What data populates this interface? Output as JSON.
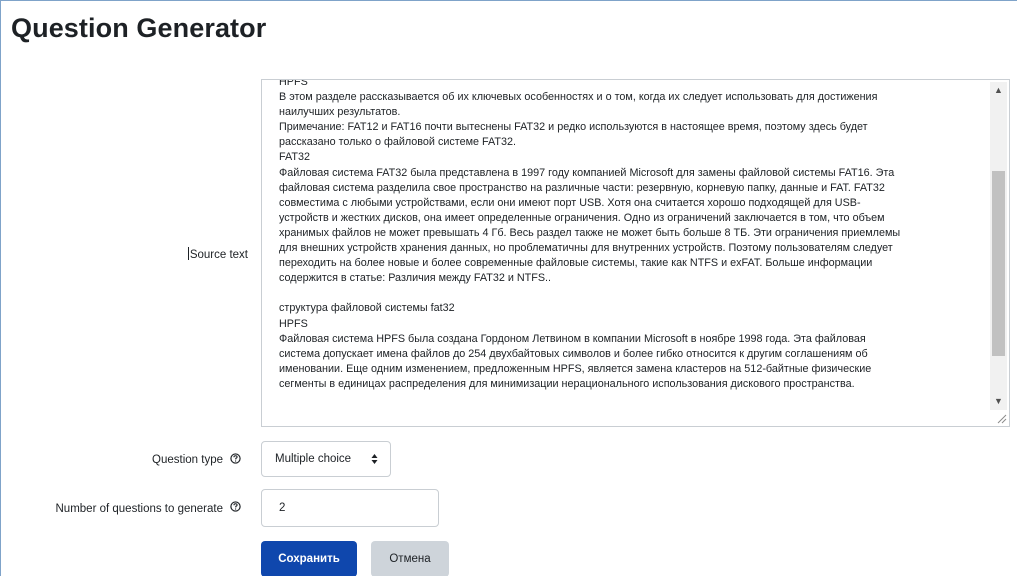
{
  "page": {
    "title": "Question Generator"
  },
  "source_text": {
    "label": "Source text",
    "lines": [
      "HPFS",
      "В этом разделе рассказывается об их ключевых особенностях и о том, когда их следует использовать для достижения",
      "наилучших результатов.",
      "Примечание: FAT12 и FAT16 почти вытеснены FAT32 и редко используются в настоящее время, поэтому здесь будет",
      "рассказано только о файловой системе FAT32.",
      "FAT32",
      "Файловая система FAT32 была представлена в 1997 году компанией Microsoft для замены файловой системы FAT16. Эта",
      "файловая система разделила свое пространство на различные части: резервную, корневую папку, данные и FAT. FAT32",
      "совместима с любыми устройствами, если они имеют порт USB. Хотя она считается хорошо подходящей для USB-",
      "устройств и жестких дисков, она имеет определенные ограничения. Одно из ограничений заключается в том, что объем",
      "хранимых файлов не может превышать 4 Гб. Весь раздел также не может быть больше 8 ТБ. Эти ограничения приемлемы",
      "для внешних устройств хранения данных, но проблематичны для внутренних устройств. Поэтому пользователям следует",
      "переходить на более новые и более современные файловые системы, такие как NTFS и exFAT. Больше информации",
      "содержится в статье: Различия между FAT32 и NTFS..",
      "",
      "структура файловой системы fat32",
      "HPFS",
      "Файловая система HPFS была создана Гордоном Летвином в компании Microsoft в ноябре 1998 года. Эта файловая",
      "система допускает имена файлов до 254 двухбайтовых символов и более гибко относится к другим соглашениям об",
      "именовании. Еще одним изменением, предложенным HPFS, является замена кластеров на 512-байтные физические",
      "сегменты в единицах распределения для минимизации нерационального использования дискового пространства."
    ]
  },
  "question_type": {
    "label": "Question type",
    "selected": "Multiple choice"
  },
  "num_questions": {
    "label": "Number of questions to generate",
    "value": "2"
  },
  "buttons": {
    "save": "Сохранить",
    "cancel": "Отмена"
  },
  "colors": {
    "primary": "#0f47ad",
    "secondary": "#ced4da",
    "text": "#1d2125",
    "border": "#c9ced3",
    "frame": "#7fa3c9"
  },
  "icons": {
    "help": "question-circle-icon",
    "select_arrow": "up-down-arrows-icon",
    "scroll_up": "triangle-up-icon",
    "scroll_down": "triangle-down-icon",
    "resize": "resize-grip-icon"
  }
}
